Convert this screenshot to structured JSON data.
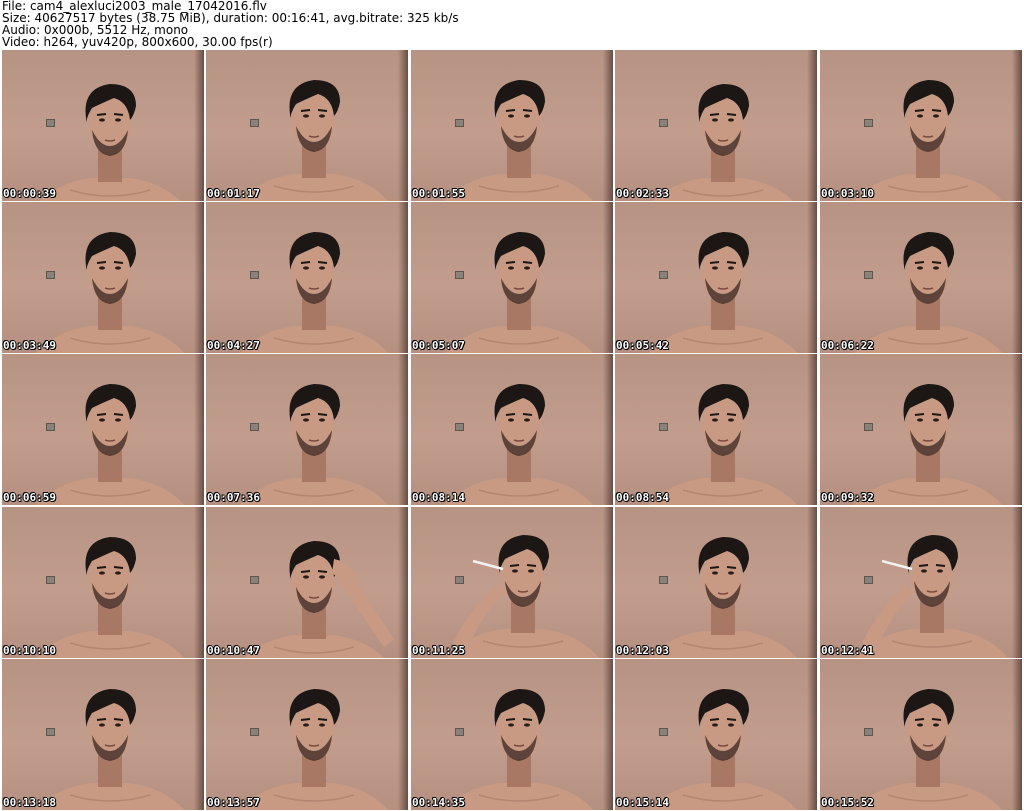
{
  "header": {
    "file_line": "File: cam4_alexluci2003_male_17042016.flv",
    "size_line": "Size: 40627517 bytes (38.75 MiB), duration: 00:16:41, avg.bitrate: 325 kb/s",
    "audio_line": "Audio: 0x000b, 5512 Hz, mono",
    "video_line": "Video: h264, yuv420p, 800x600, 30.00 fps(r)"
  },
  "thumbnails": [
    {
      "timestamp": "00:00:39",
      "pose": "tilt-down"
    },
    {
      "timestamp": "00:01:17",
      "pose": "front"
    },
    {
      "timestamp": "00:01:55",
      "pose": "front"
    },
    {
      "timestamp": "00:02:33",
      "pose": "tilt-down"
    },
    {
      "timestamp": "00:03:10",
      "pose": "front"
    },
    {
      "timestamp": "00:03:49",
      "pose": "front"
    },
    {
      "timestamp": "00:04:27",
      "pose": "front"
    },
    {
      "timestamp": "00:05:07",
      "pose": "front"
    },
    {
      "timestamp": "00:05:42",
      "pose": "front"
    },
    {
      "timestamp": "00:06:22",
      "pose": "front"
    },
    {
      "timestamp": "00:06:59",
      "pose": "front"
    },
    {
      "timestamp": "00:07:36",
      "pose": "front"
    },
    {
      "timestamp": "00:08:14",
      "pose": "front"
    },
    {
      "timestamp": "00:08:54",
      "pose": "front"
    },
    {
      "timestamp": "00:09:32",
      "pose": "front"
    },
    {
      "timestamp": "00:10:10",
      "pose": "front"
    },
    {
      "timestamp": "00:10:47",
      "pose": "hand-in-hair"
    },
    {
      "timestamp": "00:11:25",
      "pose": "smoking"
    },
    {
      "timestamp": "00:12:03",
      "pose": "front"
    },
    {
      "timestamp": "00:12:41",
      "pose": "smoking"
    },
    {
      "timestamp": "00:13:18",
      "pose": "front"
    },
    {
      "timestamp": "00:13:57",
      "pose": "front"
    },
    {
      "timestamp": "00:14:35",
      "pose": "front"
    },
    {
      "timestamp": "00:15:14",
      "pose": "front"
    },
    {
      "timestamp": "00:15:52",
      "pose": "front"
    }
  ]
}
